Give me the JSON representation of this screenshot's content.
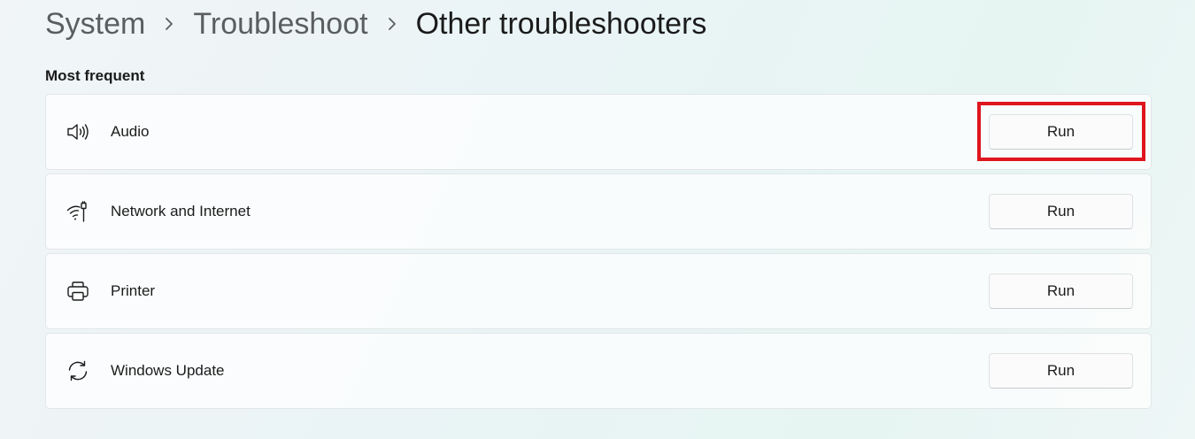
{
  "breadcrumb": {
    "items": [
      {
        "label": "System"
      },
      {
        "label": "Troubleshoot"
      },
      {
        "label": "Other troubleshooters"
      }
    ],
    "separator_icon": "chevron-right-icon"
  },
  "section": {
    "title": "Most frequent"
  },
  "troubleshooters": [
    {
      "label": "Audio",
      "icon": "speaker-icon",
      "button_label": "Run"
    },
    {
      "label": "Network and Internet",
      "icon": "wifi-ethernet-icon",
      "button_label": "Run"
    },
    {
      "label": "Printer",
      "icon": "printer-icon",
      "button_label": "Run"
    },
    {
      "label": "Windows Update",
      "icon": "sync-arrows-icon",
      "button_label": "Run"
    }
  ],
  "highlight": {
    "target": "audio-run-button",
    "color": "#e0161e"
  },
  "colors": {
    "text_primary": "#1b1b1b",
    "text_secondary": "#5a5e60",
    "card_border": "#e2e6e8"
  }
}
